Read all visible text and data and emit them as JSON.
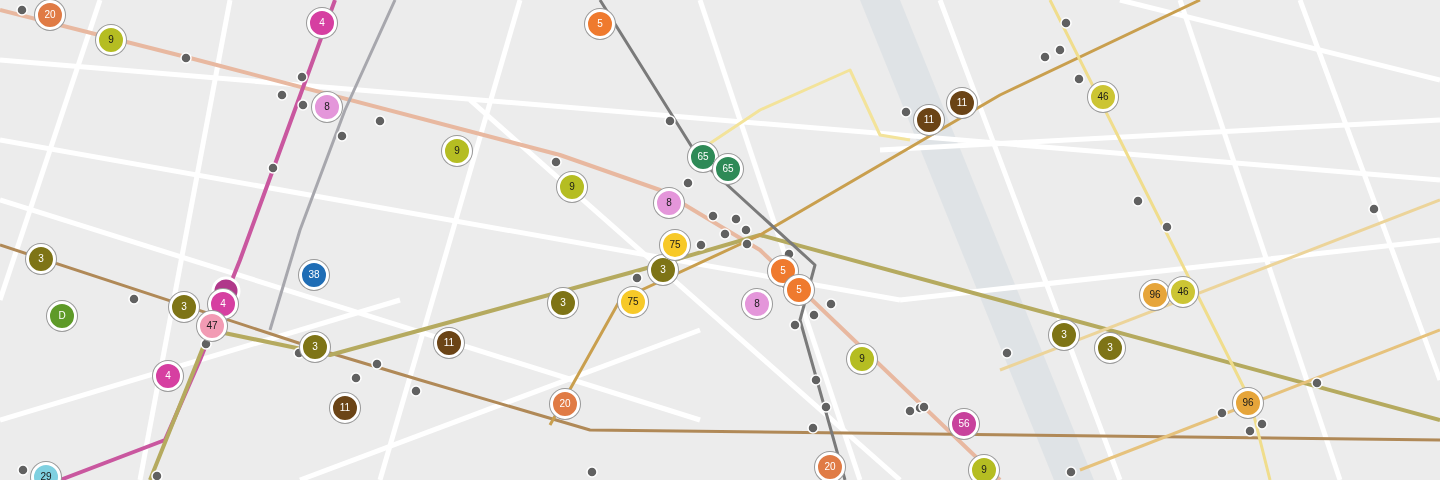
{
  "map": {
    "markers": [
      {
        "label": "20",
        "color": "#e07b45"
      },
      {
        "label": "9",
        "color": "#b5bd22"
      },
      {
        "label": "4",
        "color": "#d63fa1"
      },
      {
        "label": "5",
        "color": "#ef7a2e"
      },
      {
        "label": "8",
        "color": "#e496da"
      },
      {
        "label": "11",
        "color": "#6b4416"
      },
      {
        "label": "11",
        "color": "#6b4416"
      },
      {
        "label": "46",
        "color": "#ccc534"
      },
      {
        "label": "9",
        "color": "#b5bd22"
      },
      {
        "label": "9",
        "color": "#b5bd22"
      },
      {
        "label": "8",
        "color": "#e496da"
      },
      {
        "label": "65",
        "color": "#2e8a57"
      },
      {
        "label": "65",
        "color": "#2e8a57"
      },
      {
        "label": "3",
        "color": "#7e7416"
      },
      {
        "label": "3",
        "color": "#7e7416"
      },
      {
        "label": "4",
        "color": "#d63fa1"
      },
      {
        "label": "38",
        "color": "#1f6db5"
      },
      {
        "label": "3",
        "color": "#7e7416"
      },
      {
        "label": "75",
        "color": "#f7c928"
      },
      {
        "label": "3",
        "color": "#7e7416"
      },
      {
        "label": "75",
        "color": "#f7c928"
      },
      {
        "label": "8",
        "color": "#e496da"
      },
      {
        "label": "5",
        "color": "#ef7a2e"
      },
      {
        "label": "5",
        "color": "#ef7a2e"
      },
      {
        "label": "96",
        "color": "#e6a53a"
      },
      {
        "label": "46",
        "color": "#ccc534"
      },
      {
        "label": "D",
        "color": "#5e9a28"
      },
      {
        "label": "4",
        "color": "#d63fa1"
      },
      {
        "label": "47",
        "color": "#f29bb4"
      },
      {
        "label": "3",
        "color": "#7e7416"
      },
      {
        "label": "11",
        "color": "#6b4416"
      },
      {
        "label": "9",
        "color": "#b5bd22"
      },
      {
        "label": "3",
        "color": "#7e7416"
      },
      {
        "label": "3",
        "color": "#7e7416"
      },
      {
        "label": "11",
        "color": "#6b4416"
      },
      {
        "label": "20",
        "color": "#e07b45"
      },
      {
        "label": "56",
        "color": "#c8429c"
      },
      {
        "label": "96",
        "color": "#e6a53a"
      },
      {
        "label": "29",
        "color": "#7fd0e0"
      },
      {
        "label": "20",
        "color": "#e07b45"
      },
      {
        "label": "9",
        "color": "#b5bd22"
      }
    ]
  }
}
